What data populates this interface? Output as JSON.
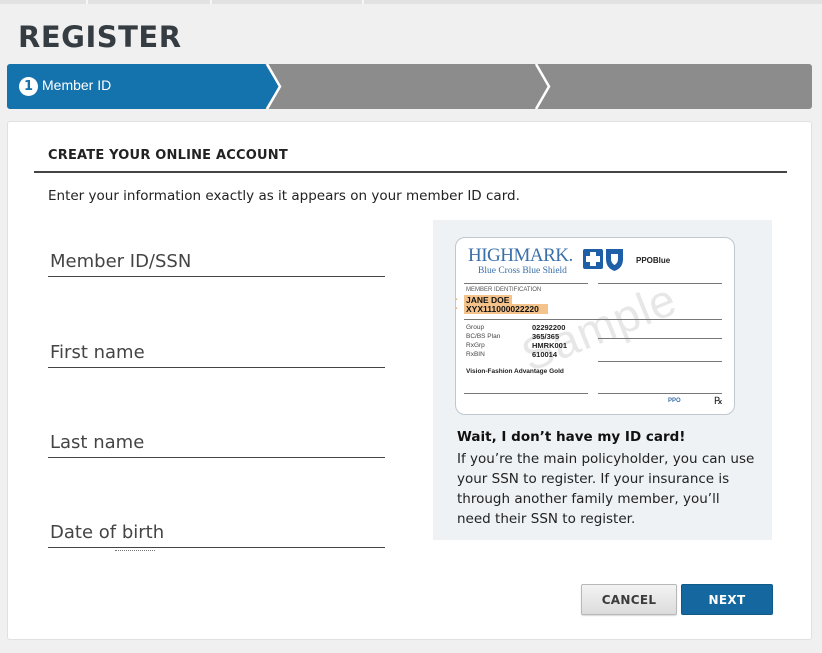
{
  "page": {
    "title": "REGISTER"
  },
  "stepper": {
    "steps": [
      {
        "number": "1",
        "label": "Member ID",
        "active": true
      },
      {
        "number": "",
        "label": "",
        "active": false
      },
      {
        "number": "",
        "label": "",
        "active": false
      }
    ]
  },
  "form": {
    "section_title": "CREATE YOUR ONLINE ACCOUNT",
    "instructions": "Enter your information exactly as it appears on your member ID card.",
    "fields": {
      "member_id": {
        "placeholder": "Member ID/SSN",
        "value": ""
      },
      "first_name": {
        "placeholder": "First name",
        "value": ""
      },
      "last_name": {
        "placeholder": "Last name",
        "value": ""
      },
      "dob": {
        "placeholder": "Date of birth",
        "value": ""
      }
    }
  },
  "id_card": {
    "brand_name": "HIGHMARK.",
    "brand_sub": "Blue Cross Blue Shield",
    "plan_label": "PPOBlue",
    "member_id_label": "MEMBER IDENTIFICATION",
    "member_name": "JANE DOE",
    "member_number": "XYX111000022220",
    "rows": [
      {
        "key": "Group",
        "value": "02292200"
      },
      {
        "key": "BC/BS Plan",
        "value": "365/365"
      },
      {
        "key": "RxGrp",
        "value": "HMRK001"
      },
      {
        "key": "RxBIN",
        "value": "610014"
      }
    ],
    "vision": "Vision-Fashion Advantage Gold",
    "watermark": "Sample",
    "ppo_badge": "PPO",
    "rx_symbol": "℞"
  },
  "no_card": {
    "title": "Wait, I don’t have my ID card!",
    "body": "If you’re the main policyholder, you can use your SSN to register. If your insurance is through another family member, you’ll need their SSN to register."
  },
  "buttons": {
    "cancel": "CANCEL",
    "next": "NEXT"
  },
  "colors": {
    "accent": "#1472ad",
    "stepper_inactive": "#8c8c8c",
    "card_highlight": "#f4c38c"
  }
}
